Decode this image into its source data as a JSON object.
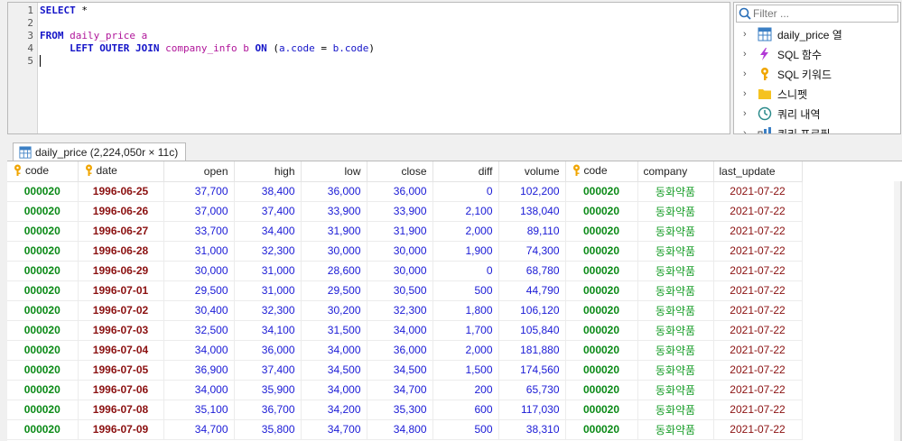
{
  "editor": {
    "line_numbers": [
      "1",
      "2",
      "3",
      "4",
      "5"
    ],
    "line1": {
      "kw_select": "SELECT",
      "star": " *"
    },
    "line3": {
      "kw_from": "FROM",
      "table": "daily_price",
      "alias": " a"
    },
    "line4": {
      "indent": "     ",
      "kw_join": "LEFT OUTER JOIN",
      "table": "company_info",
      "alias": " b ",
      "kw_on": "ON",
      "cond_open": " (",
      "lhs": "a.code",
      "eq": " = ",
      "rhs": "b.code",
      "cond_close": ")"
    }
  },
  "sidepanel": {
    "filter_placeholder": "Filter ...",
    "items": [
      {
        "label": "daily_price 열",
        "icon": "table-icon"
      },
      {
        "label": "SQL 함수",
        "icon": "function-icon"
      },
      {
        "label": "SQL 키워드",
        "icon": "key-icon"
      },
      {
        "label": "스니펫",
        "icon": "folder-icon"
      },
      {
        "label": "쿼리 내역",
        "icon": "history-icon"
      },
      {
        "label": "쿼리 프로필",
        "icon": "profile-icon"
      }
    ]
  },
  "result_tab": {
    "label": "daily_price (2,224,050r × 11c)",
    "close": "×"
  },
  "grid": {
    "columns": [
      "code",
      "date",
      "open",
      "high",
      "low",
      "close",
      "diff",
      "volume",
      "code",
      "company",
      "last_update"
    ],
    "rows": [
      [
        "000020",
        "1996-06-25",
        "37,700",
        "38,400",
        "36,000",
        "36,000",
        "0",
        "102,200",
        "000020",
        "동화약품",
        "2021-07-22"
      ],
      [
        "000020",
        "1996-06-26",
        "37,000",
        "37,400",
        "33,900",
        "33,900",
        "2,100",
        "138,040",
        "000020",
        "동화약품",
        "2021-07-22"
      ],
      [
        "000020",
        "1996-06-27",
        "33,700",
        "34,400",
        "31,900",
        "31,900",
        "2,000",
        "89,110",
        "000020",
        "동화약품",
        "2021-07-22"
      ],
      [
        "000020",
        "1996-06-28",
        "31,000",
        "32,300",
        "30,000",
        "30,000",
        "1,900",
        "74,300",
        "000020",
        "동화약품",
        "2021-07-22"
      ],
      [
        "000020",
        "1996-06-29",
        "30,000",
        "31,000",
        "28,600",
        "30,000",
        "0",
        "68,780",
        "000020",
        "동화약품",
        "2021-07-22"
      ],
      [
        "000020",
        "1996-07-01",
        "29,500",
        "31,000",
        "29,500",
        "30,500",
        "500",
        "44,790",
        "000020",
        "동화약품",
        "2021-07-22"
      ],
      [
        "000020",
        "1996-07-02",
        "30,400",
        "32,300",
        "30,200",
        "32,300",
        "1,800",
        "106,120",
        "000020",
        "동화약품",
        "2021-07-22"
      ],
      [
        "000020",
        "1996-07-03",
        "32,500",
        "34,100",
        "31,500",
        "34,000",
        "1,700",
        "105,840",
        "000020",
        "동화약품",
        "2021-07-22"
      ],
      [
        "000020",
        "1996-07-04",
        "34,000",
        "36,000",
        "34,000",
        "36,000",
        "2,000",
        "181,880",
        "000020",
        "동화약품",
        "2021-07-22"
      ],
      [
        "000020",
        "1996-07-05",
        "36,900",
        "37,400",
        "34,500",
        "34,500",
        "1,500",
        "174,560",
        "000020",
        "동화약품",
        "2021-07-22"
      ],
      [
        "000020",
        "1996-07-06",
        "34,000",
        "35,900",
        "34,000",
        "34,700",
        "200",
        "65,730",
        "000020",
        "동화약품",
        "2021-07-22"
      ],
      [
        "000020",
        "1996-07-08",
        "35,100",
        "36,700",
        "34,200",
        "35,300",
        "600",
        "117,030",
        "000020",
        "동화약품",
        "2021-07-22"
      ],
      [
        "000020",
        "1996-07-09",
        "34,700",
        "35,800",
        "34,700",
        "34,800",
        "500",
        "38,310",
        "000020",
        "동화약품",
        "2021-07-22"
      ]
    ]
  }
}
